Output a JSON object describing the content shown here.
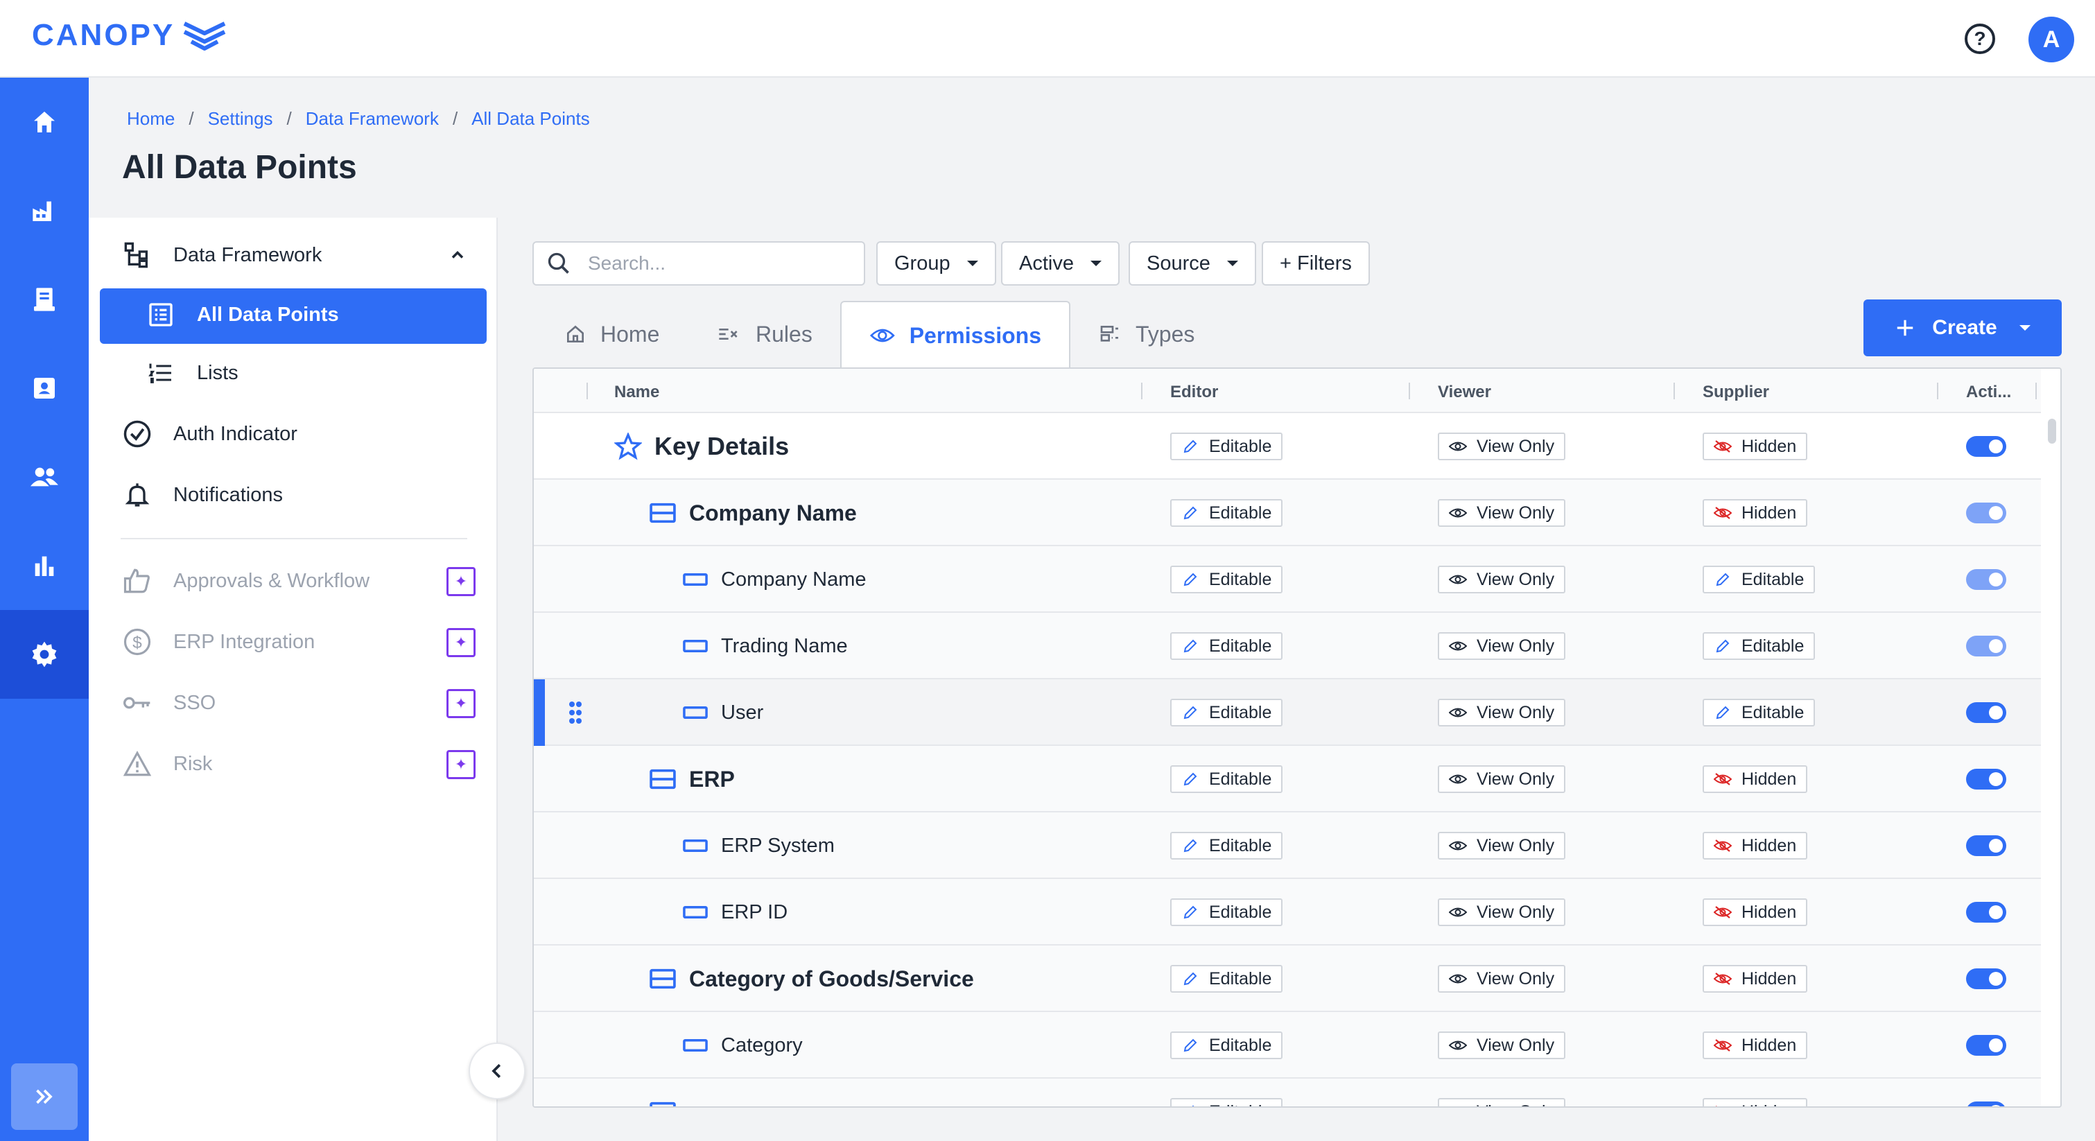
{
  "app": {
    "logo_text": "CANOPY",
    "brand_color": "#2f6df5"
  },
  "topbar": {
    "help_icon": "question-circle-icon",
    "avatar_initial": "A"
  },
  "rail": {
    "items": [
      {
        "icon": "home-icon"
      },
      {
        "icon": "factory-icon"
      },
      {
        "icon": "document-icon"
      },
      {
        "icon": "contact-card-icon"
      },
      {
        "icon": "users-icon"
      },
      {
        "icon": "bar-chart-icon"
      },
      {
        "icon": "gear-icon",
        "active": true
      }
    ],
    "expand_icon": "double-chevron-right-icon"
  },
  "breadcrumb": [
    "Home",
    "Settings",
    "Data Framework",
    "All Data Points"
  ],
  "breadcrumb_separator": "/",
  "page_title": "All Data Points",
  "subnav": {
    "section": {
      "label": "Data Framework",
      "icon": "hierarchy-icon",
      "expanded": true
    },
    "items": [
      {
        "label": "All Data Points",
        "icon": "list-box-icon",
        "active": true
      },
      {
        "label": "Lists",
        "icon": "numbered-list-icon"
      },
      {
        "label": "Auth Indicator",
        "icon": "check-circle-icon"
      },
      {
        "label": "Notifications",
        "icon": "bell-icon"
      }
    ],
    "locked_items": [
      {
        "label": "Approvals & Workflow",
        "icon": "thumbs-up-icon"
      },
      {
        "label": "ERP Integration",
        "icon": "dollar-circle-icon"
      },
      {
        "label": "SSO",
        "icon": "key-icon"
      },
      {
        "label": "Risk",
        "icon": "warning-triangle-icon"
      }
    ]
  },
  "filters": {
    "search_placeholder": "Search...",
    "buttons": [
      "Group",
      "Active",
      "Source"
    ],
    "more_filters": "+ Filters"
  },
  "tabs": [
    {
      "label": "Home",
      "icon": "home-outline-icon"
    },
    {
      "label": "Rules",
      "icon": "rules-icon"
    },
    {
      "label": "Permissions",
      "icon": "eye-icon",
      "active": true
    },
    {
      "label": "Types",
      "icon": "types-icon"
    }
  ],
  "create_button": {
    "label": "Create",
    "icon": "plus-icon"
  },
  "table": {
    "columns": [
      "Name",
      "Editor",
      "Viewer",
      "Supplier",
      "Acti..."
    ],
    "rows": [
      {
        "name": "Key Details",
        "level": 0,
        "editor": "Editable",
        "viewer": "View Only",
        "supplier": "Hidden",
        "active": true
      },
      {
        "name": "Company Name",
        "level": 1,
        "editor": "Editable",
        "viewer": "View Only",
        "supplier": "Hidden",
        "active": true,
        "muted": true
      },
      {
        "name": "Company Name",
        "level": 2,
        "editor": "Editable",
        "viewer": "View Only",
        "supplier": "Editable",
        "active": true,
        "muted": true
      },
      {
        "name": "Trading Name",
        "level": 2,
        "editor": "Editable",
        "viewer": "View Only",
        "supplier": "Editable",
        "active": true,
        "muted": true
      },
      {
        "name": "User",
        "level": 2,
        "editor": "Editable",
        "viewer": "View Only",
        "supplier": "Editable",
        "active": true,
        "selected": true
      },
      {
        "name": "ERP",
        "level": 1,
        "editor": "Editable",
        "viewer": "View Only",
        "supplier": "Hidden",
        "active": true
      },
      {
        "name": "ERP System",
        "level": 2,
        "editor": "Editable",
        "viewer": "View Only",
        "supplier": "Hidden",
        "active": true
      },
      {
        "name": "ERP ID",
        "level": 2,
        "editor": "Editable",
        "viewer": "View Only",
        "supplier": "Hidden",
        "active": true
      },
      {
        "name": "Category of Goods/Service",
        "level": 1,
        "editor": "Editable",
        "viewer": "View Only",
        "supplier": "Hidden",
        "active": true
      },
      {
        "name": "Category",
        "level": 2,
        "editor": "Editable",
        "viewer": "View Only",
        "supplier": "Hidden",
        "active": true
      },
      {
        "name": "",
        "level": 1,
        "editor": "Editable",
        "viewer": "View Only",
        "supplier": "Hidden",
        "active": true
      }
    ]
  }
}
